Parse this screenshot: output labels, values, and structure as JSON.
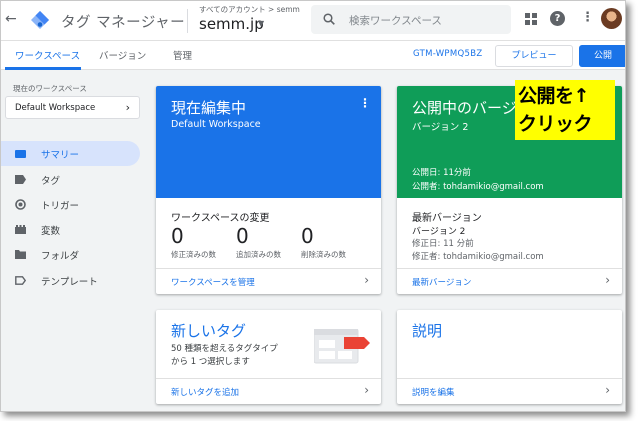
{
  "header": {
    "back_icon": "arrow-back-icon",
    "app_title": "タグ マネージャー",
    "account_crumb": "すべてのアカウント > semm",
    "container_name": "semm.jp",
    "search_placeholder": "検索ワークスペース",
    "icons": [
      "apps-icon",
      "help-icon",
      "more-vert-icon",
      "avatar"
    ]
  },
  "subnav": {
    "tabs": [
      {
        "label": "ワークスペース",
        "active": true
      },
      {
        "label": "バージョン",
        "active": false
      },
      {
        "label": "管理",
        "active": false
      }
    ],
    "container_id": "GTM-WPMQ5BZ",
    "preview_label": "プレビュー",
    "publish_label": "公開"
  },
  "sidebar": {
    "workspace_label": "現在のワークスペース",
    "workspace_value": "Default Workspace",
    "items": [
      {
        "label": "サマリー",
        "icon": "summary-icon",
        "active": true
      },
      {
        "label": "タグ",
        "icon": "tag-icon",
        "active": false
      },
      {
        "label": "トリガー",
        "icon": "trigger-icon",
        "active": false
      },
      {
        "label": "変数",
        "icon": "variables-icon",
        "active": false
      },
      {
        "label": "フォルダ",
        "icon": "folder-icon",
        "active": false
      },
      {
        "label": "テンプレート",
        "icon": "template-icon",
        "active": false
      }
    ]
  },
  "cards": {
    "editing": {
      "title": "現在編集中",
      "subtitle": "Default Workspace",
      "changes_title": "ワークスペースの変更",
      "stats": [
        {
          "value": "0",
          "label": "修正済みの数"
        },
        {
          "value": "0",
          "label": "追加済みの数"
        },
        {
          "value": "0",
          "label": "削除済みの数"
        }
      ],
      "footer_link": "ワークスペースを管理"
    },
    "published": {
      "title": "公開中のバージョン",
      "subtitle": "バージョン 2",
      "published_date": "公開日: 11分前",
      "published_by": "公開者: tohdamikio@gmail.com",
      "latest_title": "最新バージョン",
      "latest_version": "バージョン 2",
      "modified_date": "修正日: 11 分前",
      "modified_by": "修正者: tohdamikio@gmail.com",
      "footer_link": "最新バージョン"
    },
    "new_tag": {
      "title": "新しいタグ",
      "desc_line1": "50 種類を超えるタグタイプ",
      "desc_line2": "から 1 つ選択します",
      "footer_link": "新しいタグを追加"
    },
    "description": {
      "title": "説明",
      "footer_link": "説明を編集"
    }
  },
  "callout": {
    "line1": "公開を↑",
    "line2": "クリック",
    "color": "#ffff00"
  },
  "colors": {
    "accent": "#1a73e8",
    "published_green": "#0f9d58",
    "sidebar_active": "#d7e3fc"
  }
}
